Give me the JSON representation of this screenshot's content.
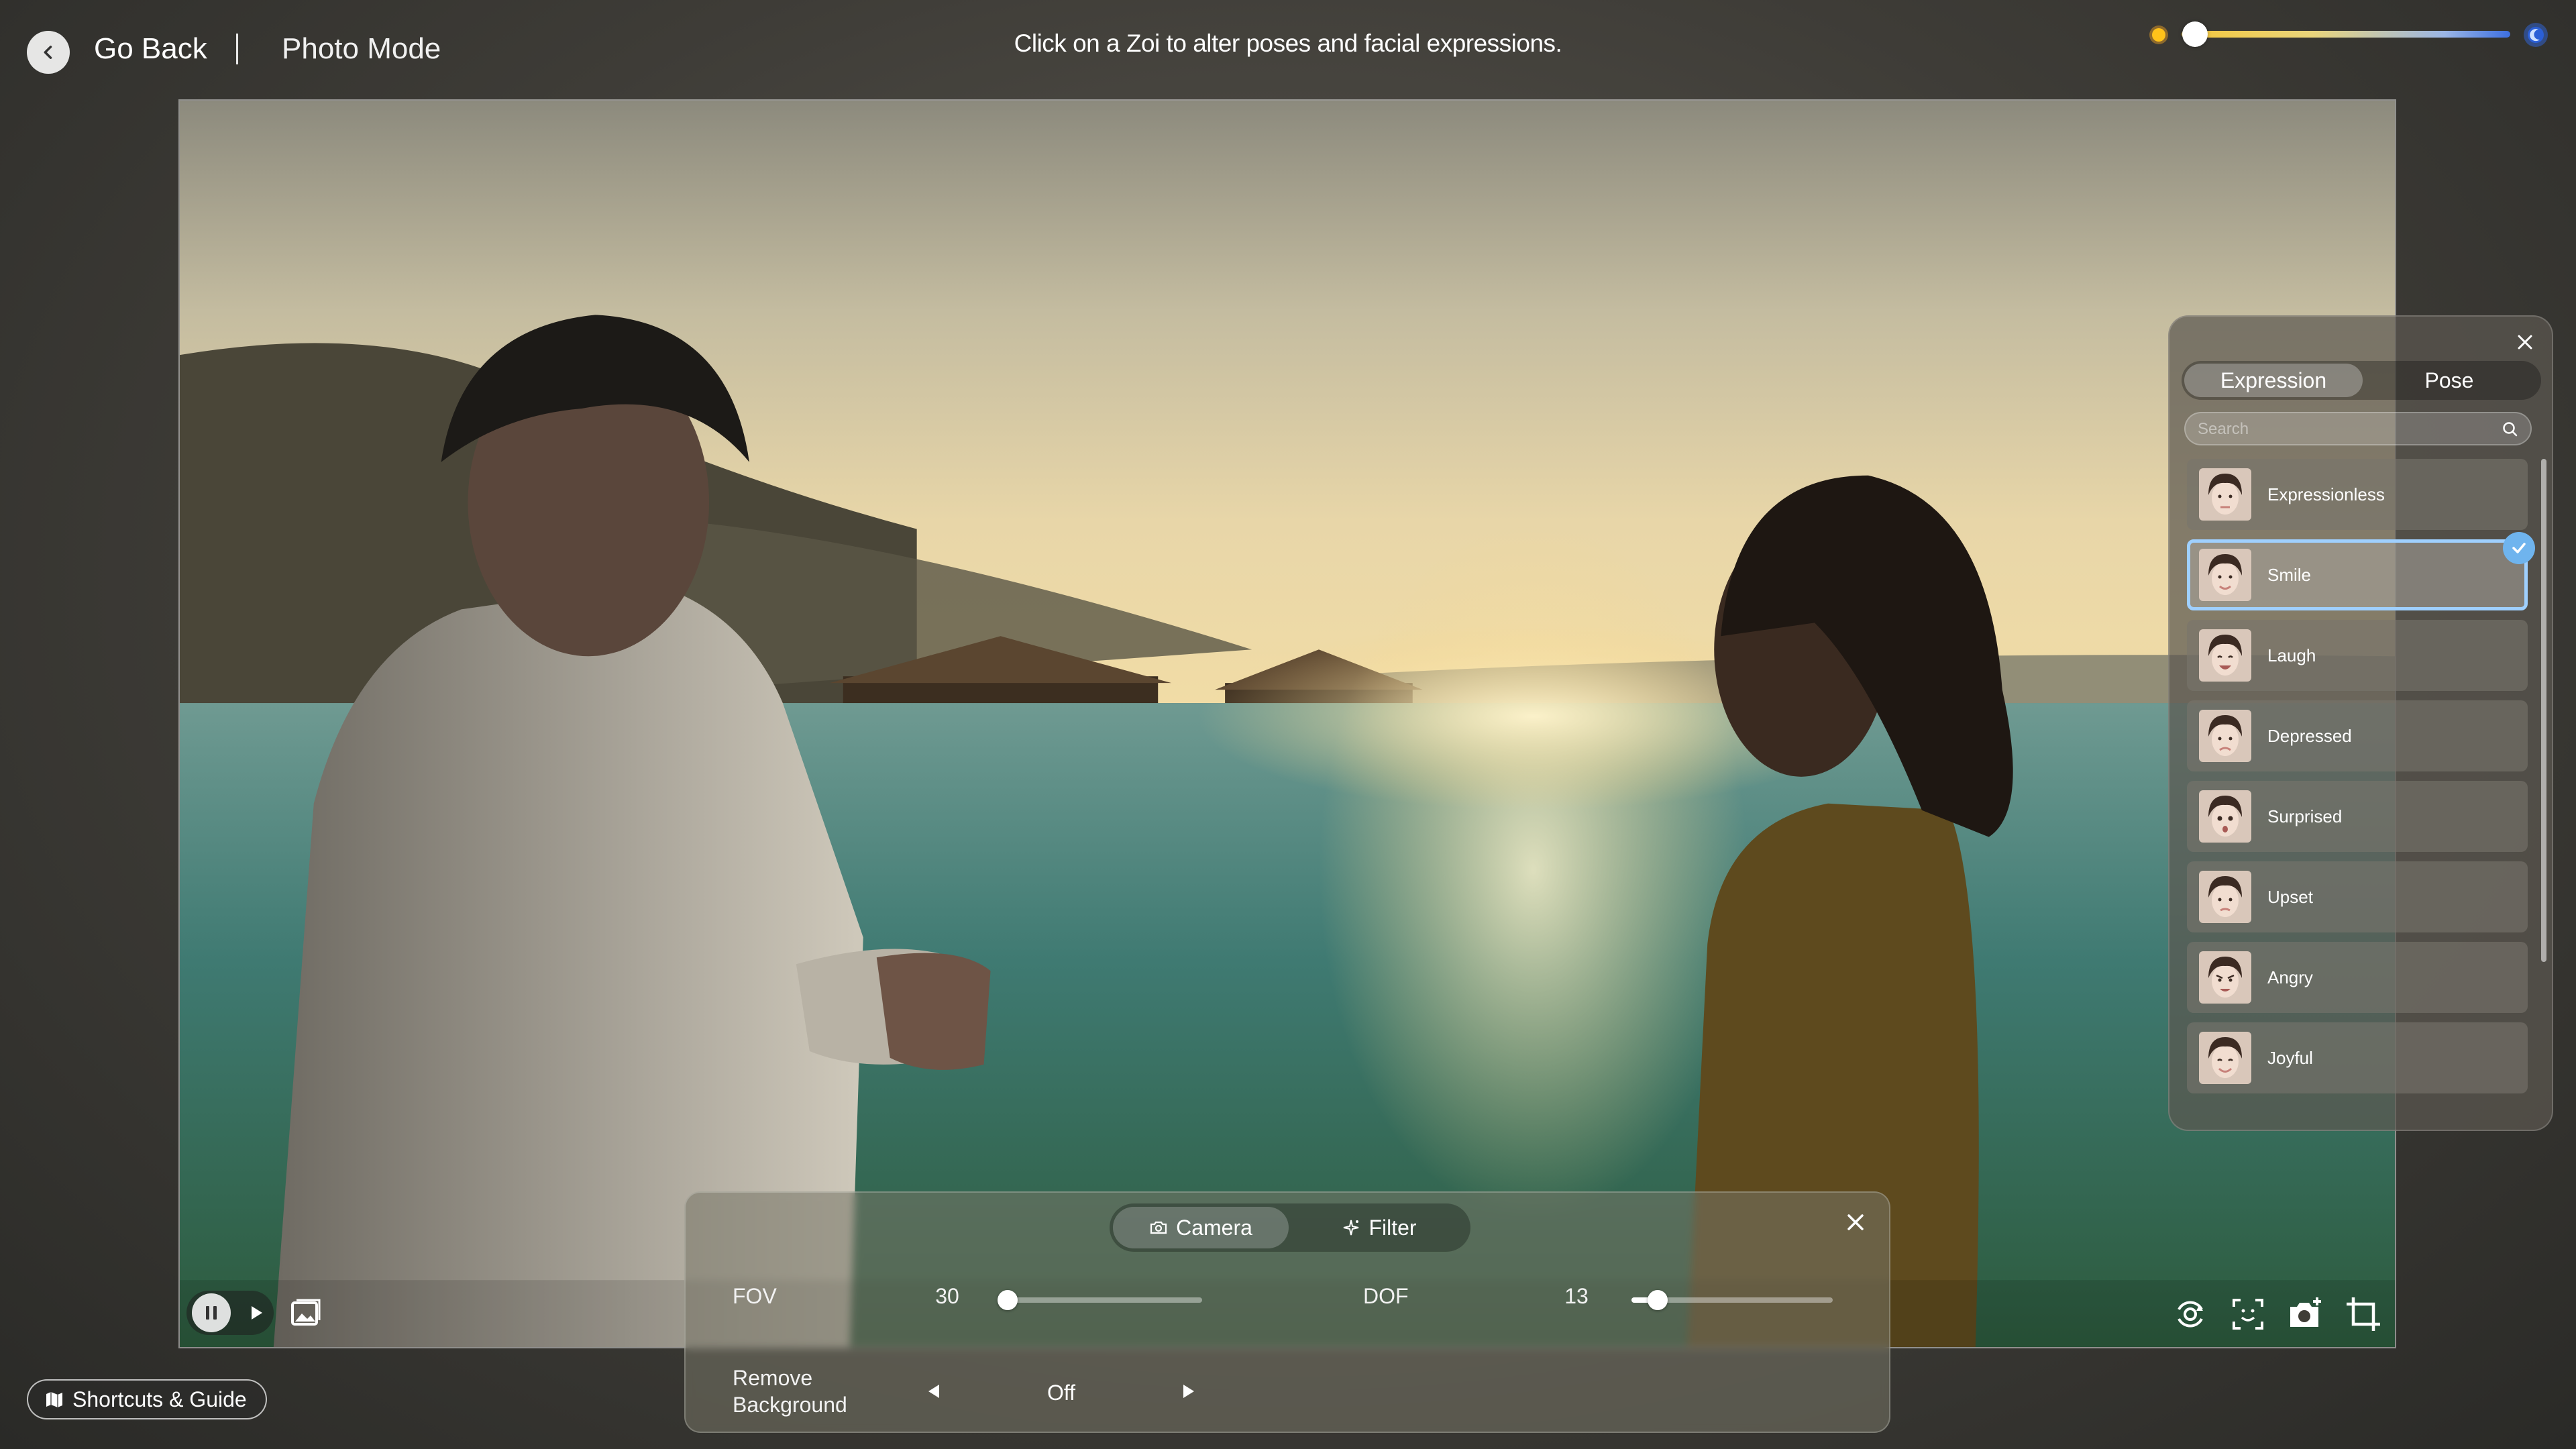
{
  "header": {
    "back_label": "Go Back",
    "title": "Photo Mode",
    "hint": "Click on a Zoi to alter poses and facial expressions."
  },
  "time_of_day": {
    "start_icon": "sun-icon",
    "end_icon": "moon-icon",
    "level": 0.04
  },
  "expression_panel": {
    "tabs": [
      {
        "label": "Expression",
        "active": true
      },
      {
        "label": "Pose",
        "active": false
      }
    ],
    "search_placeholder": "Search",
    "items": [
      {
        "label": "Expressionless",
        "selected": false
      },
      {
        "label": "Smile",
        "selected": true
      },
      {
        "label": "Laugh",
        "selected": false
      },
      {
        "label": "Depressed",
        "selected": false
      },
      {
        "label": "Surprised",
        "selected": false
      },
      {
        "label": "Upset",
        "selected": false
      },
      {
        "label": "Angry",
        "selected": false
      },
      {
        "label": "Joyful",
        "selected": false
      }
    ]
  },
  "camera_panel": {
    "tabs": [
      {
        "label": "Camera",
        "icon": "camera-icon",
        "active": true
      },
      {
        "label": "Filter",
        "icon": "sparkle-icon",
        "active": false
      }
    ],
    "fov": {
      "label": "FOV",
      "value": "30",
      "fraction": 0.0
    },
    "dof": {
      "label": "DOF",
      "value": "13",
      "fraction": 0.13
    },
    "remove_background": {
      "label_line1": "Remove",
      "label_line2": "Background",
      "value": "Off"
    }
  },
  "footer": {
    "shortcuts_label": "Shortcuts & Guide"
  },
  "colors": {
    "accent_selected": "#9fd0ff",
    "check_badge": "#6fb4ee"
  }
}
